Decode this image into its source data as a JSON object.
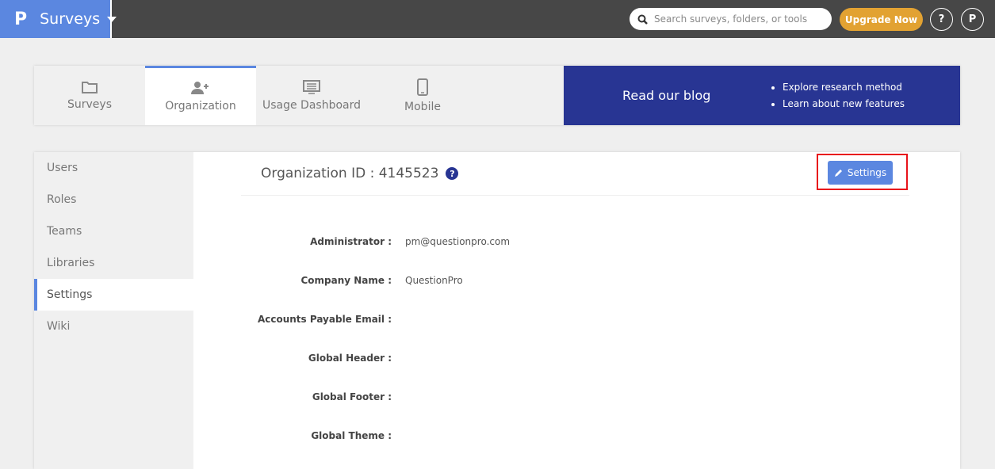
{
  "header": {
    "logo": "P",
    "app": "Surveys",
    "search_placeholder": "Search surveys, folders, or tools",
    "upgrade": "Upgrade Now",
    "help": "?",
    "avatar": "P"
  },
  "tabs": [
    {
      "label": "Surveys",
      "icon": "folder-icon"
    },
    {
      "label": "Organization",
      "icon": "user-plus-icon",
      "active": true
    },
    {
      "label": "Usage Dashboard",
      "icon": "monitor-icon"
    },
    {
      "label": "Mobile",
      "icon": "mobile-icon"
    }
  ],
  "blog": {
    "title": "Read our blog",
    "items": [
      "Explore research method",
      "Learn about new features"
    ]
  },
  "sidebar": [
    {
      "label": "Users"
    },
    {
      "label": "Roles"
    },
    {
      "label": "Teams"
    },
    {
      "label": "Libraries"
    },
    {
      "label": "Settings",
      "active": true
    },
    {
      "label": "Wiki"
    }
  ],
  "org": {
    "title": "Organization ID : 4145523",
    "help": "?",
    "settings_button": "Settings"
  },
  "fields": [
    {
      "label": "Administrator :",
      "value": "pm@questionpro.com"
    },
    {
      "label": "Company Name :",
      "value": "QuestionPro"
    },
    {
      "label": "Accounts Payable Email :",
      "value": ""
    },
    {
      "label": "Global Header :",
      "value": ""
    },
    {
      "label": "Global Footer :",
      "value": ""
    },
    {
      "label": "Global Theme :",
      "value": ""
    }
  ]
}
